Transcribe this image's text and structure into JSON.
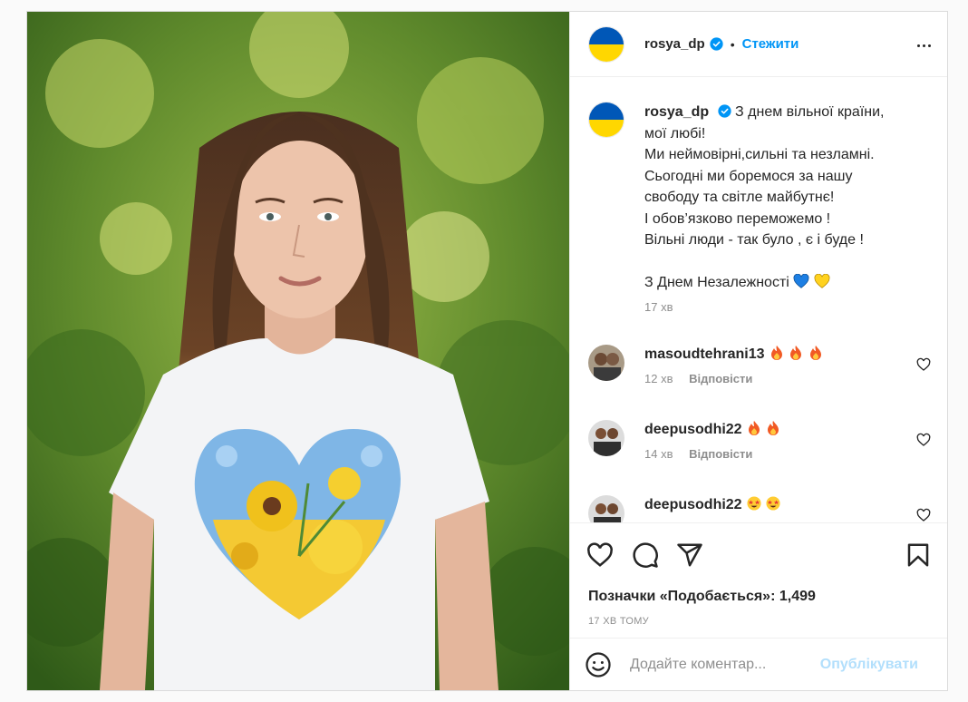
{
  "colors": {
    "flag_blue": "#0057b7",
    "flag_yellow": "#ffd700",
    "link_blue": "#0095f6"
  },
  "post": {
    "photo_alt": "woman-in-ukraine-heart-tshirt",
    "header": {
      "username": "rosya_dp",
      "separator": "•",
      "follow_label": "Стежити"
    },
    "caption": {
      "username": "rosya_dp",
      "lines": [
        "З днем вільної країни,",
        "мої любі!",
        "Ми неймовірні,сильні та незламні.",
        "Сьогодні ми боремося за нашу",
        "свободу та світле майбутнє!",
        "І обов’язково переможемо !",
        "Вільні люди - так було , є і буде !"
      ],
      "closing": "З Днем Незалежності",
      "time": "17 хв"
    },
    "comments": [
      {
        "username": "masoudtehrani13",
        "emojis": [
          "fire-icon",
          "fire-icon",
          "fire-icon"
        ],
        "time": "12 хв",
        "reply": "Відповісти"
      },
      {
        "username": "deepusodhi22",
        "emojis": [
          "fire-icon",
          "fire-icon"
        ],
        "time": "14 хв",
        "reply": "Відповісти"
      },
      {
        "username": "deepusodhi22",
        "emojis": [
          "star-eyes-icon",
          "star-eyes-icon"
        ],
        "time": "",
        "reply": ""
      }
    ],
    "likes_text": "Позначки «Подобається»: 1,499",
    "posted_ago": "17 ХВ ТОМУ",
    "comment_placeholder": "Додайте коментар...",
    "publish_label": "Опублікувати"
  }
}
